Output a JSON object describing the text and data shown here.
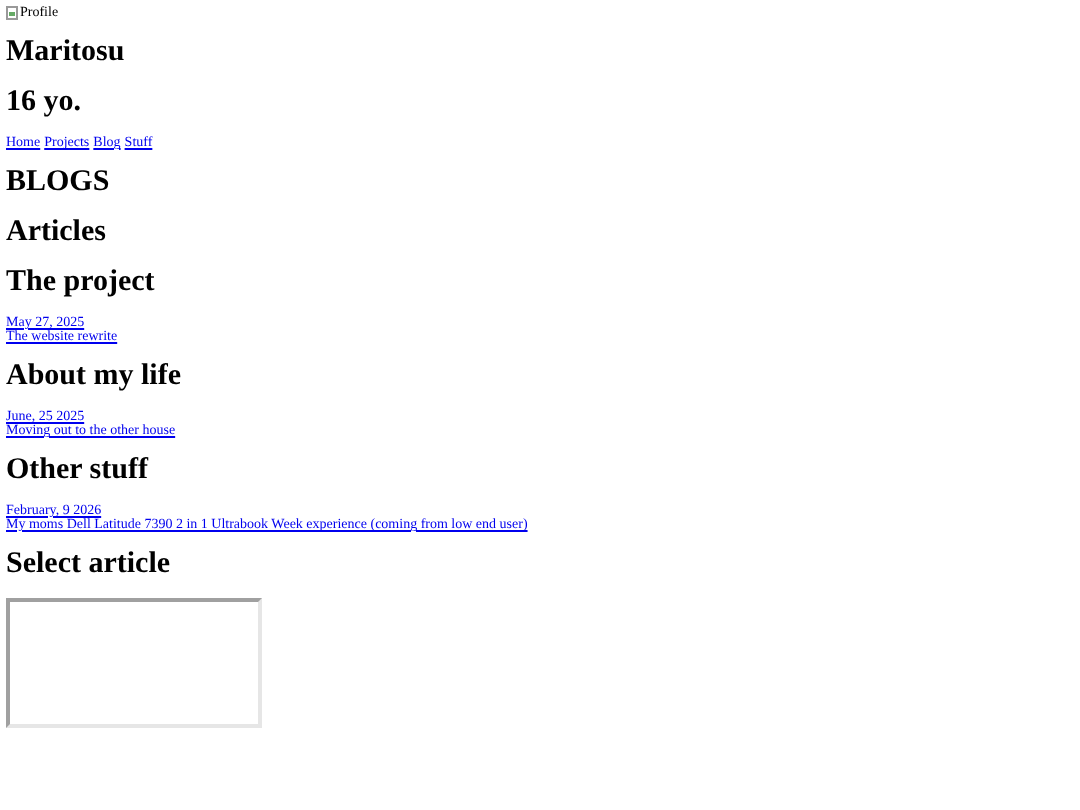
{
  "profile_image": {
    "alt": "Profile"
  },
  "name": "Maritosu",
  "age": "16 yo.",
  "nav": [
    "Home",
    "Projects",
    "Blog",
    "Stuff"
  ],
  "page_title": "BLOGS",
  "section_title": "Articles",
  "articles": [
    {
      "category": "The project",
      "date": "May 27, 2025",
      "title": "The website rewrite"
    },
    {
      "category": "About my life",
      "date": "June, 25 2025",
      "title": "Moving out to the other house"
    },
    {
      "category": "Other stuff",
      "date": "February, 9 2026",
      "title": "My moms Dell Latitude 7390 2 in 1 Ultrabook Week experience (coming from low end user)"
    }
  ],
  "viewer_title": "Select article"
}
